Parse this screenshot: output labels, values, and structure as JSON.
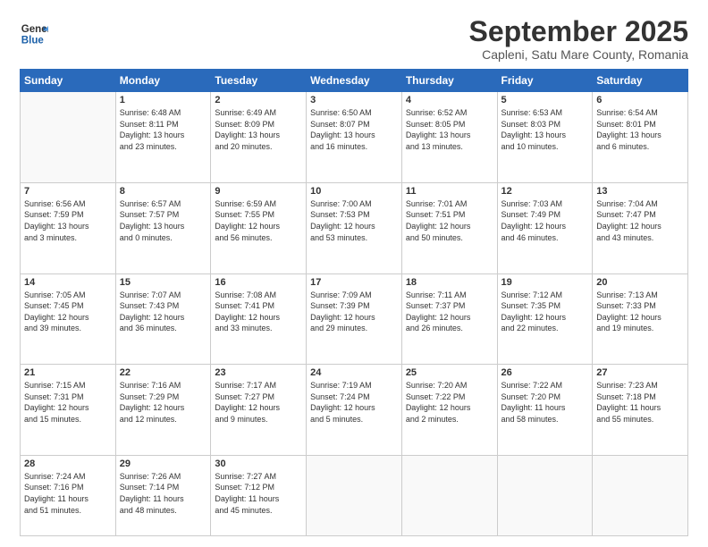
{
  "logo": {
    "line1": "General",
    "line2": "Blue"
  },
  "title": "September 2025",
  "subtitle": "Capleni, Satu Mare County, Romania",
  "days_header": [
    "Sunday",
    "Monday",
    "Tuesday",
    "Wednesday",
    "Thursday",
    "Friday",
    "Saturday"
  ],
  "weeks": [
    [
      {
        "num": "",
        "info": ""
      },
      {
        "num": "1",
        "info": "Sunrise: 6:48 AM\nSunset: 8:11 PM\nDaylight: 13 hours\nand 23 minutes."
      },
      {
        "num": "2",
        "info": "Sunrise: 6:49 AM\nSunset: 8:09 PM\nDaylight: 13 hours\nand 20 minutes."
      },
      {
        "num": "3",
        "info": "Sunrise: 6:50 AM\nSunset: 8:07 PM\nDaylight: 13 hours\nand 16 minutes."
      },
      {
        "num": "4",
        "info": "Sunrise: 6:52 AM\nSunset: 8:05 PM\nDaylight: 13 hours\nand 13 minutes."
      },
      {
        "num": "5",
        "info": "Sunrise: 6:53 AM\nSunset: 8:03 PM\nDaylight: 13 hours\nand 10 minutes."
      },
      {
        "num": "6",
        "info": "Sunrise: 6:54 AM\nSunset: 8:01 PM\nDaylight: 13 hours\nand 6 minutes."
      }
    ],
    [
      {
        "num": "7",
        "info": "Sunrise: 6:56 AM\nSunset: 7:59 PM\nDaylight: 13 hours\nand 3 minutes."
      },
      {
        "num": "8",
        "info": "Sunrise: 6:57 AM\nSunset: 7:57 PM\nDaylight: 13 hours\nand 0 minutes."
      },
      {
        "num": "9",
        "info": "Sunrise: 6:59 AM\nSunset: 7:55 PM\nDaylight: 12 hours\nand 56 minutes."
      },
      {
        "num": "10",
        "info": "Sunrise: 7:00 AM\nSunset: 7:53 PM\nDaylight: 12 hours\nand 53 minutes."
      },
      {
        "num": "11",
        "info": "Sunrise: 7:01 AM\nSunset: 7:51 PM\nDaylight: 12 hours\nand 50 minutes."
      },
      {
        "num": "12",
        "info": "Sunrise: 7:03 AM\nSunset: 7:49 PM\nDaylight: 12 hours\nand 46 minutes."
      },
      {
        "num": "13",
        "info": "Sunrise: 7:04 AM\nSunset: 7:47 PM\nDaylight: 12 hours\nand 43 minutes."
      }
    ],
    [
      {
        "num": "14",
        "info": "Sunrise: 7:05 AM\nSunset: 7:45 PM\nDaylight: 12 hours\nand 39 minutes."
      },
      {
        "num": "15",
        "info": "Sunrise: 7:07 AM\nSunset: 7:43 PM\nDaylight: 12 hours\nand 36 minutes."
      },
      {
        "num": "16",
        "info": "Sunrise: 7:08 AM\nSunset: 7:41 PM\nDaylight: 12 hours\nand 33 minutes."
      },
      {
        "num": "17",
        "info": "Sunrise: 7:09 AM\nSunset: 7:39 PM\nDaylight: 12 hours\nand 29 minutes."
      },
      {
        "num": "18",
        "info": "Sunrise: 7:11 AM\nSunset: 7:37 PM\nDaylight: 12 hours\nand 26 minutes."
      },
      {
        "num": "19",
        "info": "Sunrise: 7:12 AM\nSunset: 7:35 PM\nDaylight: 12 hours\nand 22 minutes."
      },
      {
        "num": "20",
        "info": "Sunrise: 7:13 AM\nSunset: 7:33 PM\nDaylight: 12 hours\nand 19 minutes."
      }
    ],
    [
      {
        "num": "21",
        "info": "Sunrise: 7:15 AM\nSunset: 7:31 PM\nDaylight: 12 hours\nand 15 minutes."
      },
      {
        "num": "22",
        "info": "Sunrise: 7:16 AM\nSunset: 7:29 PM\nDaylight: 12 hours\nand 12 minutes."
      },
      {
        "num": "23",
        "info": "Sunrise: 7:17 AM\nSunset: 7:27 PM\nDaylight: 12 hours\nand 9 minutes."
      },
      {
        "num": "24",
        "info": "Sunrise: 7:19 AM\nSunset: 7:24 PM\nDaylight: 12 hours\nand 5 minutes."
      },
      {
        "num": "25",
        "info": "Sunrise: 7:20 AM\nSunset: 7:22 PM\nDaylight: 12 hours\nand 2 minutes."
      },
      {
        "num": "26",
        "info": "Sunrise: 7:22 AM\nSunset: 7:20 PM\nDaylight: 11 hours\nand 58 minutes."
      },
      {
        "num": "27",
        "info": "Sunrise: 7:23 AM\nSunset: 7:18 PM\nDaylight: 11 hours\nand 55 minutes."
      }
    ],
    [
      {
        "num": "28",
        "info": "Sunrise: 7:24 AM\nSunset: 7:16 PM\nDaylight: 11 hours\nand 51 minutes."
      },
      {
        "num": "29",
        "info": "Sunrise: 7:26 AM\nSunset: 7:14 PM\nDaylight: 11 hours\nand 48 minutes."
      },
      {
        "num": "30",
        "info": "Sunrise: 7:27 AM\nSunset: 7:12 PM\nDaylight: 11 hours\nand 45 minutes."
      },
      {
        "num": "",
        "info": ""
      },
      {
        "num": "",
        "info": ""
      },
      {
        "num": "",
        "info": ""
      },
      {
        "num": "",
        "info": ""
      }
    ]
  ]
}
